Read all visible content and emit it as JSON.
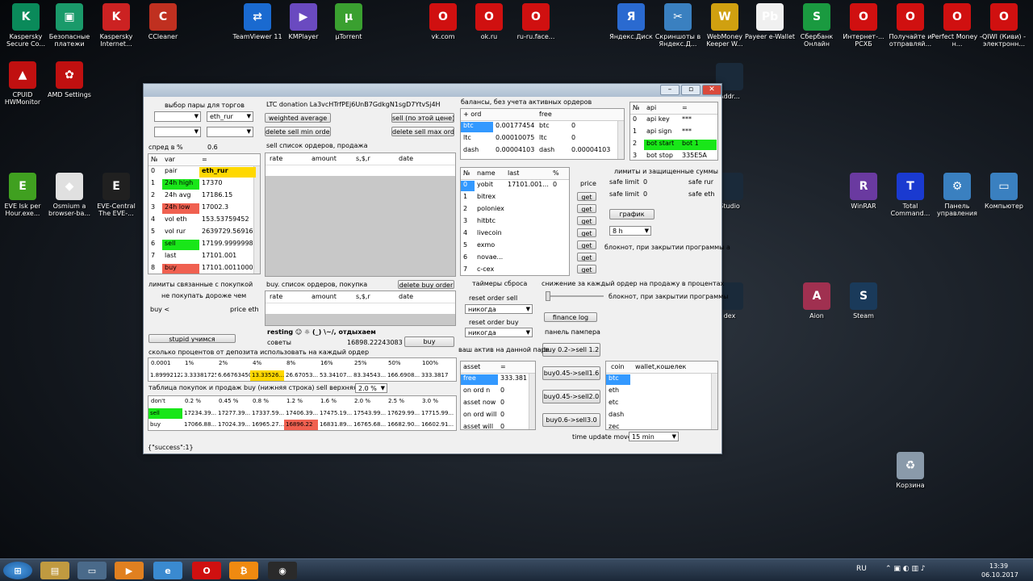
{
  "desktop": {
    "icons": [
      {
        "label": "Kaspersky Secure Co...",
        "color": "#0a8a5a",
        "glyph": "K"
      },
      {
        "label": "Безопасные платежи",
        "color": "#1a9a6a",
        "glyph": "▣"
      },
      {
        "label": "Kaspersky Internet...",
        "color": "#cc2222",
        "glyph": "K"
      },
      {
        "label": "CCleaner",
        "color": "#c03020",
        "glyph": "C"
      },
      {
        "label": "TeamViewer 11",
        "color": "#1a6ad0",
        "glyph": "⇄"
      },
      {
        "label": "KMPlayer",
        "color": "#6a4ac0",
        "glyph": "▶"
      },
      {
        "label": "µTorrent",
        "color": "#3aa030",
        "glyph": "µ"
      },
      {
        "label": "vk.com",
        "color": "#d01010",
        "glyph": "O"
      },
      {
        "label": "ok.ru",
        "color": "#d01010",
        "glyph": "O"
      },
      {
        "label": "ru-ru.face...",
        "color": "#d01010",
        "glyph": "O"
      },
      {
        "label": "Яндекс.Диск",
        "color": "#2a6ad0",
        "glyph": "Я"
      },
      {
        "label": "Скриншоты в Яндекс.Д...",
        "color": "#3a80c0",
        "glyph": "✂"
      },
      {
        "label": "WebMoney Keeper W...",
        "color": "#d0a010",
        "glyph": "W"
      },
      {
        "label": "Payeer e-Wallet",
        "color": "#f0f0f0",
        "glyph": "Pb"
      },
      {
        "label": "Сбербанк Онлайн",
        "color": "#1a9a40",
        "glyph": "S"
      },
      {
        "label": "Интернет-... РСХБ",
        "color": "#d01010",
        "glyph": "O"
      },
      {
        "label": "Получайте и отправляй...",
        "color": "#d01010",
        "glyph": "O"
      },
      {
        "label": "Perfect Money – н...",
        "color": "#d01010",
        "glyph": "O"
      },
      {
        "label": "QIWI (Киви) - электронн...",
        "color": "#d01010",
        "glyph": "O"
      },
      {
        "label": "CPUID HWMonitor",
        "color": "#c01010",
        "glyph": "▲"
      },
      {
        "label": "AMD Settings",
        "color": "#c01010",
        "glyph": "✿"
      },
      {
        "label": "EVE Isk per Hour.exe...",
        "color": "#40a020",
        "glyph": "E"
      },
      {
        "label": "Osmium a browser-ba...",
        "color": "#e0e0e0",
        "glyph": "◆"
      },
      {
        "label": "EVE-Central The EVE-...",
        "color": "#202020",
        "glyph": "E"
      },
      {
        "label": "WinRAR",
        "color": "#6a3aa0",
        "glyph": "R"
      },
      {
        "label": "Total Command...",
        "color": "#1a3ad0",
        "glyph": "T"
      },
      {
        "label": "Панель управления",
        "color": "#3a80c0",
        "glyph": "⚙"
      },
      {
        "label": "Компьютер",
        "color": "#3a80c0",
        "glyph": "▭"
      },
      {
        "label": "Aion",
        "color": "#a03050",
        "glyph": "A"
      },
      {
        "label": "Steam",
        "color": "#1a3a5a",
        "glyph": "S"
      },
      {
        "label": "Корзина",
        "color": "#8a9aaa",
        "glyph": "♻"
      },
      {
        "label": "Studio",
        "color": "#1a2a3a",
        "glyph": ""
      },
      {
        "label": "Addr...",
        "color": "#1a2a3a",
        "glyph": ""
      },
      {
        "label": "dex",
        "color": "#1a2a3a",
        "glyph": ""
      }
    ]
  },
  "win": {
    "pair_select_title": "выбор пары для торгов",
    "pair_combo": "eth_rur",
    "spread_label": "спред в %",
    "spread_value": "0.6",
    "ltc_donation": "LTC donation  La3vcHTrfPEj6UnB7GdkgN1sgD7YtvSj4H",
    "btn_weighted": "weighted average",
    "btn_delete_sell_min": "delete sell min order",
    "btn_sell_this_price": "sell (по этой цене)",
    "btn_delete_sell_max": "delete sell max ord",
    "sell_list_title": "sell список ордеров, продажа",
    "order_cols": [
      "rate",
      "amount",
      "s,$,r",
      "date"
    ],
    "main_table": {
      "cols": [
        "№",
        "var",
        "="
      ],
      "rows": [
        [
          "0",
          "pair",
          "eth_rur"
        ],
        [
          "1",
          "24h high",
          "17370"
        ],
        [
          "2",
          "24h avg",
          "17186.15"
        ],
        [
          "3",
          "24h low",
          "17002.3"
        ],
        [
          "4",
          "vol eth",
          "153.53759452"
        ],
        [
          "5",
          "vol rur",
          "2639729.56916"
        ],
        [
          "6",
          "sell",
          "17199.9999998"
        ],
        [
          "7",
          "last",
          "17101.001"
        ],
        [
          "8",
          "buy",
          "17101.0011000"
        ]
      ]
    },
    "balances_title": "балансы, без учета активных ордеров",
    "balances": {
      "cols": [
        "+ ord",
        "",
        "free",
        ""
      ],
      "rows": [
        [
          "btc",
          "0.00177454",
          "btc",
          "0"
        ],
        [
          "ltc",
          "0.00010075",
          "ltc",
          "0"
        ],
        [
          "dash",
          "0.00004103",
          "dash",
          "0.00004103"
        ]
      ]
    },
    "api": {
      "cols": [
        "№",
        "api",
        "="
      ],
      "rows": [
        [
          "0",
          "api key",
          "***"
        ],
        [
          "1",
          "api sign",
          "***"
        ],
        [
          "2",
          "bot start",
          "bot 1"
        ],
        [
          "3",
          "bot stop",
          "335E5A"
        ]
      ]
    },
    "exchanges": {
      "cols": [
        "№",
        "name",
        "last",
        "%"
      ],
      "rows": [
        [
          "0",
          "yobit",
          "17101.001...",
          "0"
        ],
        [
          "1",
          "bitrex",
          "",
          ""
        ],
        [
          "2",
          "poloniex",
          "",
          ""
        ],
        [
          "3",
          "hitbtc",
          "",
          ""
        ],
        [
          "4",
          "livecoin",
          "",
          ""
        ],
        [
          "5",
          "exmo",
          "",
          ""
        ],
        [
          "6",
          "novae...",
          "",
          ""
        ],
        [
          "7",
          "c-cex",
          "",
          ""
        ]
      ]
    },
    "price_label": "price",
    "get_label": "get",
    "limits_title": "лимиты и защищенные суммы",
    "safe_limit_label": "safe limit",
    "safe_limit_value": "0",
    "safe_rur": "safe rur",
    "safe_eth": "safe eth",
    "btn_graph": "график",
    "graph_combo": "8 h",
    "notepad_text": "блокнот, при закрытии программы а",
    "notepad_text2": "блокнот, при закрытии программы",
    "buy_limits_title": "лимиты связанные с покупкой",
    "no_buy_pricier": "не покупать дороже чем",
    "buy_lt": "buy <",
    "price_eth": "price eth",
    "btn_stupid": "stupid учимся",
    "buy_list_title": "buy. список ордеров, покупка",
    "btn_delete_buy": "delete buy order",
    "resting": "resting ☺ ☼ (_) \\~/, отдыхаем",
    "advice_label": "советы",
    "advice_value": "16898.22243083",
    "btn_buy": "buy",
    "reset_timers_title": "таймеры сброса",
    "reset_sell_label": "reset order sell",
    "reset_sell_value": "никогда",
    "reset_buy_label": "reset order buy",
    "reset_buy_value": "никогда",
    "decrease_title": "снижение за каждый ордер на продажу в процентах",
    "btn_finance_log": "finance log",
    "pump_title": "панель пампера",
    "pump_buttons": [
      "buy 0.2->sell 1.2",
      "buy0.45->sell1.6",
      "buy0.45->sell2.0",
      "buy0.6->sell3.0"
    ],
    "your_assets_title": "ваш актив на данной паре",
    "assets": {
      "cols": [
        "asset",
        "="
      ],
      "rows": [
        [
          "free",
          "333.381"
        ],
        [
          "on ord n",
          "0"
        ],
        [
          "asset now",
          "0"
        ],
        [
          "on ord will",
          "0"
        ],
        [
          "asset will",
          "0"
        ]
      ]
    },
    "wallet": {
      "cols": [
        "coin",
        "wallet,кошелек"
      ],
      "rows": [
        "btc",
        "eth",
        "etc",
        "dash",
        "zec"
      ]
    },
    "deposit_title": "сколько процентов от депозита использовать на каждый ордер",
    "deposit_cols": [
      "0.0001",
      "1%",
      "2%",
      "4%",
      "8%",
      "16%",
      "25%",
      "50%",
      "100%"
    ],
    "deposit_vals": [
      "1.89992122",
      "3.33381725",
      "6.66763450",
      "13.33526...",
      "26.67053...",
      "53.34107...",
      "83.34543...",
      "166.6908...",
      "333.3817"
    ],
    "buysell_title": "таблица покупок и продаж buy (нижняя строка) sell верхняя",
    "buysell_combo": "2.0 %",
    "bs_cols": [
      "don't",
      "0.2 %",
      "0.45 %",
      "0.8 %",
      "1.2 %",
      "1.6 %",
      "2.0 %",
      "2.5 %",
      "3.0 %"
    ],
    "bs_sell": [
      "sell",
      "17234.39...",
      "17277.39...",
      "17337.59...",
      "17406.39...",
      "17475.19...",
      "17543.99...",
      "17629.99...",
      "17715.99..."
    ],
    "bs_buy": [
      "buy",
      "17066.88...",
      "17024.39...",
      "16965.27...",
      "16896.22",
      "16831.89...",
      "16765.68...",
      "16682.90...",
      "16602.91..."
    ],
    "time_update_label": "time update move",
    "time_update_value": "15 min",
    "status": "{\"success\":1}"
  },
  "taskbar": {
    "lang": "RU",
    "time": "13:39",
    "date": "06.10.2017"
  }
}
